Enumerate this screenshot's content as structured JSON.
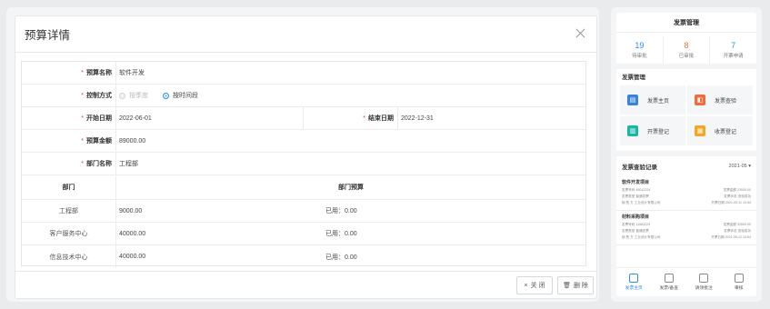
{
  "modal": {
    "title": "预算详情",
    "fields": {
      "name_label": "预算名称",
      "name_value": "软件开发",
      "control_label": "控制方式",
      "control_opt1": "按季度",
      "control_opt2": "按时间段",
      "start_label": "开始日期",
      "start_value": "2022-06-01",
      "end_label": "结束日期",
      "end_value": "2022-12-31",
      "amount_label": "预算金额",
      "amount_value": "89000.00",
      "dept_label": "部门名称",
      "dept_value": "工程部"
    },
    "table": {
      "col1": "部门",
      "col2": "部门预算",
      "rows": [
        {
          "dept": "工程部",
          "budget": "9000.00",
          "used": "已用：0.00"
        },
        {
          "dept": "客户服务中心",
          "budget": "40000.00",
          "used": "已用：0.00"
        },
        {
          "dept": "信息技术中心",
          "budget": "40000.00",
          "used": "已用：0.00"
        }
      ]
    },
    "footer": {
      "close_label": "关 闭",
      "delete_label": "删 除"
    }
  },
  "phone": {
    "title": "发票管理",
    "stats": [
      {
        "num": "19",
        "label": "待审批",
        "color": "#2d8cf0"
      },
      {
        "num": "8",
        "label": "已审批",
        "color": "#f26b3a"
      },
      {
        "num": "7",
        "label": "开票申请",
        "color": "#2d8cf0"
      }
    ],
    "section_title": "发票管理",
    "tiles": [
      {
        "label": "发票主页",
        "color": "#3d82d6",
        "glyph": "▤"
      },
      {
        "label": "发票查验",
        "color": "#f26b3a",
        "glyph": "◧"
      },
      {
        "label": "开票登记",
        "color": "#1ab5a4",
        "glyph": "▥"
      },
      {
        "label": "收票登记",
        "color": "#f5a623",
        "glyph": "▦"
      }
    ],
    "records_title": "发票查验记录",
    "year_select": "2021-05 ▾",
    "records": [
      {
        "name": "软件开发项目",
        "l1a": "发票号码 45012224",
        "l1b": "发票金额 23000.00",
        "l2a": "发票类型 普通发票",
        "l2b": "发票状态 查验成功",
        "l3a": "销 售 方 工业设计有限公司",
        "l3b": "开票日期 2021-09-11 10:54"
      },
      {
        "name": "材料采购项目",
        "l1a": "发票号码 11583224",
        "l1b": "发票金额 32600.00",
        "l2a": "发票类型 普通发票",
        "l2b": "发票状态 查验成功",
        "l3a": "销 售 方 工业设计有限公司",
        "l3b": "开票日期 2021-09-12 10:54"
      }
    ],
    "tabs": [
      {
        "label": "发票主页"
      },
      {
        "label": "发票/备查"
      },
      {
        "label": "请领批注"
      },
      {
        "label": "审核"
      }
    ]
  }
}
